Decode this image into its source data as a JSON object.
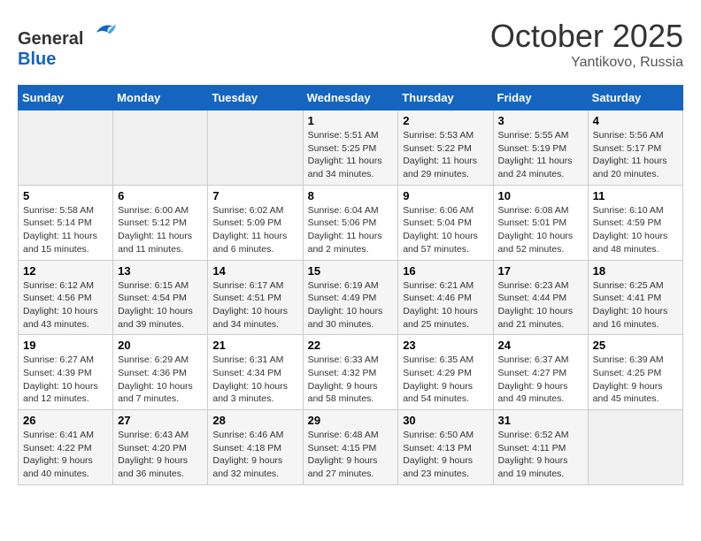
{
  "header": {
    "logo_general": "General",
    "logo_blue": "Blue",
    "month_year": "October 2025",
    "location": "Yantikovo, Russia"
  },
  "days_of_week": [
    "Sunday",
    "Monday",
    "Tuesday",
    "Wednesday",
    "Thursday",
    "Friday",
    "Saturday"
  ],
  "weeks": [
    [
      {
        "day": "",
        "info": ""
      },
      {
        "day": "",
        "info": ""
      },
      {
        "day": "",
        "info": ""
      },
      {
        "day": "1",
        "info": "Sunrise: 5:51 AM\nSunset: 5:25 PM\nDaylight: 11 hours and 34 minutes."
      },
      {
        "day": "2",
        "info": "Sunrise: 5:53 AM\nSunset: 5:22 PM\nDaylight: 11 hours and 29 minutes."
      },
      {
        "day": "3",
        "info": "Sunrise: 5:55 AM\nSunset: 5:19 PM\nDaylight: 11 hours and 24 minutes."
      },
      {
        "day": "4",
        "info": "Sunrise: 5:56 AM\nSunset: 5:17 PM\nDaylight: 11 hours and 20 minutes."
      }
    ],
    [
      {
        "day": "5",
        "info": "Sunrise: 5:58 AM\nSunset: 5:14 PM\nDaylight: 11 hours and 15 minutes."
      },
      {
        "day": "6",
        "info": "Sunrise: 6:00 AM\nSunset: 5:12 PM\nDaylight: 11 hours and 11 minutes."
      },
      {
        "day": "7",
        "info": "Sunrise: 6:02 AM\nSunset: 5:09 PM\nDaylight: 11 hours and 6 minutes."
      },
      {
        "day": "8",
        "info": "Sunrise: 6:04 AM\nSunset: 5:06 PM\nDaylight: 11 hours and 2 minutes."
      },
      {
        "day": "9",
        "info": "Sunrise: 6:06 AM\nSunset: 5:04 PM\nDaylight: 10 hours and 57 minutes."
      },
      {
        "day": "10",
        "info": "Sunrise: 6:08 AM\nSunset: 5:01 PM\nDaylight: 10 hours and 52 minutes."
      },
      {
        "day": "11",
        "info": "Sunrise: 6:10 AM\nSunset: 4:59 PM\nDaylight: 10 hours and 48 minutes."
      }
    ],
    [
      {
        "day": "12",
        "info": "Sunrise: 6:12 AM\nSunset: 4:56 PM\nDaylight: 10 hours and 43 minutes."
      },
      {
        "day": "13",
        "info": "Sunrise: 6:15 AM\nSunset: 4:54 PM\nDaylight: 10 hours and 39 minutes."
      },
      {
        "day": "14",
        "info": "Sunrise: 6:17 AM\nSunset: 4:51 PM\nDaylight: 10 hours and 34 minutes."
      },
      {
        "day": "15",
        "info": "Sunrise: 6:19 AM\nSunset: 4:49 PM\nDaylight: 10 hours and 30 minutes."
      },
      {
        "day": "16",
        "info": "Sunrise: 6:21 AM\nSunset: 4:46 PM\nDaylight: 10 hours and 25 minutes."
      },
      {
        "day": "17",
        "info": "Sunrise: 6:23 AM\nSunset: 4:44 PM\nDaylight: 10 hours and 21 minutes."
      },
      {
        "day": "18",
        "info": "Sunrise: 6:25 AM\nSunset: 4:41 PM\nDaylight: 10 hours and 16 minutes."
      }
    ],
    [
      {
        "day": "19",
        "info": "Sunrise: 6:27 AM\nSunset: 4:39 PM\nDaylight: 10 hours and 12 minutes."
      },
      {
        "day": "20",
        "info": "Sunrise: 6:29 AM\nSunset: 4:36 PM\nDaylight: 10 hours and 7 minutes."
      },
      {
        "day": "21",
        "info": "Sunrise: 6:31 AM\nSunset: 4:34 PM\nDaylight: 10 hours and 3 minutes."
      },
      {
        "day": "22",
        "info": "Sunrise: 6:33 AM\nSunset: 4:32 PM\nDaylight: 9 hours and 58 minutes."
      },
      {
        "day": "23",
        "info": "Sunrise: 6:35 AM\nSunset: 4:29 PM\nDaylight: 9 hours and 54 minutes."
      },
      {
        "day": "24",
        "info": "Sunrise: 6:37 AM\nSunset: 4:27 PM\nDaylight: 9 hours and 49 minutes."
      },
      {
        "day": "25",
        "info": "Sunrise: 6:39 AM\nSunset: 4:25 PM\nDaylight: 9 hours and 45 minutes."
      }
    ],
    [
      {
        "day": "26",
        "info": "Sunrise: 6:41 AM\nSunset: 4:22 PM\nDaylight: 9 hours and 40 minutes."
      },
      {
        "day": "27",
        "info": "Sunrise: 6:43 AM\nSunset: 4:20 PM\nDaylight: 9 hours and 36 minutes."
      },
      {
        "day": "28",
        "info": "Sunrise: 6:46 AM\nSunset: 4:18 PM\nDaylight: 9 hours and 32 minutes."
      },
      {
        "day": "29",
        "info": "Sunrise: 6:48 AM\nSunset: 4:15 PM\nDaylight: 9 hours and 27 minutes."
      },
      {
        "day": "30",
        "info": "Sunrise: 6:50 AM\nSunset: 4:13 PM\nDaylight: 9 hours and 23 minutes."
      },
      {
        "day": "31",
        "info": "Sunrise: 6:52 AM\nSunset: 4:11 PM\nDaylight: 9 hours and 19 minutes."
      },
      {
        "day": "",
        "info": ""
      }
    ]
  ]
}
